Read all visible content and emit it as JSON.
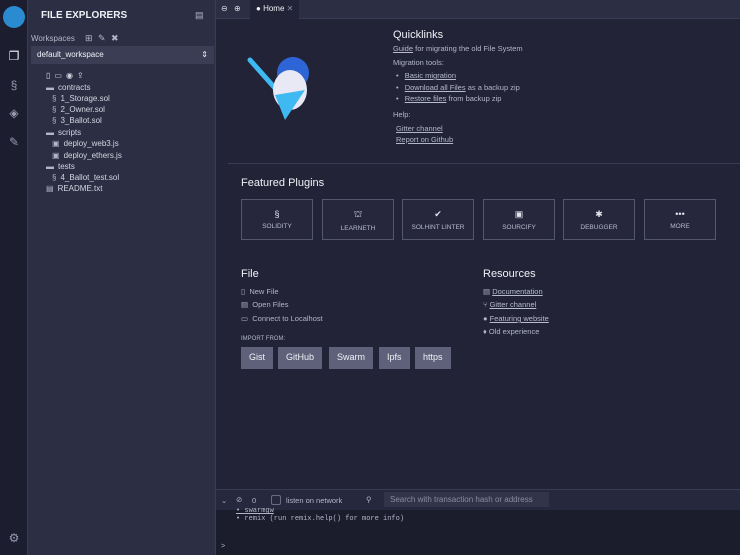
{
  "sidebar": {
    "title": "FILE EXPLORERS",
    "workspaces_label": "Workspaces",
    "workspace": "default_workspace",
    "tree": [
      "contracts",
      "1_Storage.sol",
      "2_Owner.sol",
      "3_Ballot.sol",
      "scripts",
      "deploy_web3.js",
      "deploy_ethers.js",
      "tests",
      "4_Ballot_test.sol",
      "README.txt"
    ]
  },
  "tab": {
    "label": "Home"
  },
  "quicklinks": {
    "title": "Quicklinks",
    "guide": "Guide",
    "guide_rest": "for migrating the old File System",
    "migration": "Migration tools:",
    "basic": "Basic migration",
    "download": "Download all Files",
    "download_rest": "as a backup zip",
    "restore": "Restore files",
    "restore_rest": "from backup zip",
    "help": "Help:",
    "gitter": "Gitter channel",
    "github": "Report on Github"
  },
  "featured": {
    "title": "Featured Plugins",
    "plugins": [
      "SOLIDITY",
      "LEARNETH",
      "SOLHINT LINTER",
      "SOURCIFY",
      "DEBUGGER",
      "MORE"
    ]
  },
  "file": {
    "title": "File",
    "items": [
      "New File",
      "Open Files",
      "Connect to Localhost"
    ],
    "import_label": "IMPORT FROM:",
    "imports": [
      "Gist",
      "GitHub",
      "Swarm",
      "Ipfs",
      "https"
    ]
  },
  "resources": {
    "title": "Resources",
    "items": [
      "Documentation",
      "Gitter channel",
      "Featuring website",
      "Old experience"
    ]
  },
  "terminal": {
    "count": "0",
    "listen": "listen on network",
    "search_placeholder": "Search with transaction hash or address",
    "lines": [
      "swarmgw",
      "remix (run remix.help() for more info)"
    ],
    "prompt": ">"
  }
}
